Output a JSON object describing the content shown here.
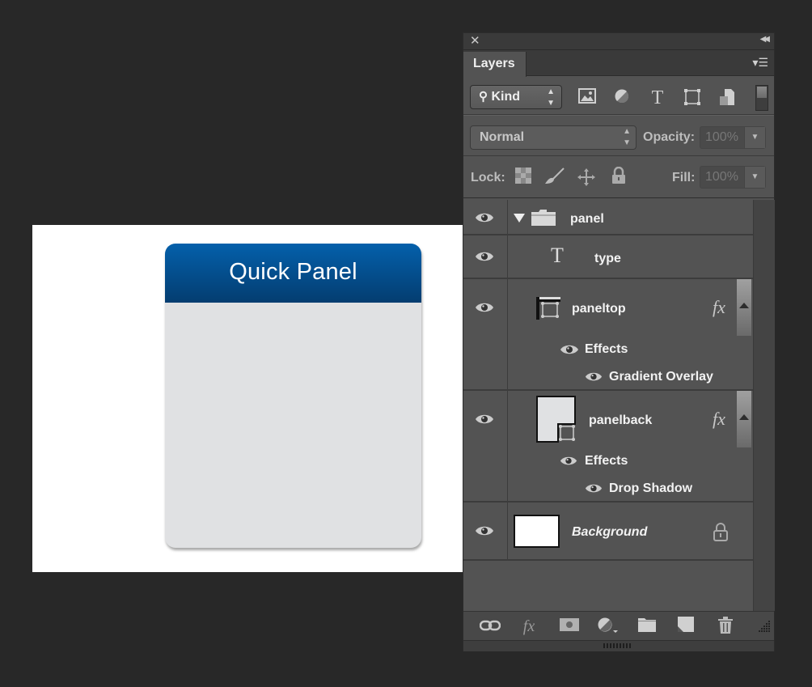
{
  "canvas": {
    "panel_title": "Quick Panel",
    "colors": {
      "header_top": "#0460ab",
      "header_bottom": "#043d70",
      "body": "#e0e1e3"
    }
  },
  "layers_panel": {
    "tab_label": "Layers",
    "icons": {
      "close": "close-icon",
      "collapse": "collapse-double-arrow-icon",
      "menu": "panel-menu-icon"
    },
    "filter": {
      "kind_label": "Kind",
      "filter_icons": [
        "image-filter-icon",
        "adjustment-filter-icon",
        "type-filter-icon",
        "shape-filter-icon",
        "smart-object-filter-icon"
      ]
    },
    "blend_mode": "Normal",
    "opacity_label": "Opacity:",
    "opacity_value": "100%",
    "lock_label": "Lock:",
    "fill_label": "Fill:",
    "fill_value": "100%",
    "layers": [
      {
        "name": "panel",
        "type": "group",
        "expanded": true
      },
      {
        "name": "type",
        "type": "text"
      },
      {
        "name": "paneltop",
        "type": "shape",
        "fx": "fx",
        "effects_label": "Effects",
        "effects": [
          "Gradient Overlay"
        ]
      },
      {
        "name": "panelback",
        "type": "shape",
        "fx": "fx",
        "effects_label": "Effects",
        "effects": [
          "Drop Shadow"
        ]
      },
      {
        "name": "Background",
        "type": "background",
        "locked": true
      }
    ],
    "bottom_icons": [
      "link-layers-icon",
      "add-style-icon",
      "add-mask-icon",
      "new-adjustment-icon",
      "new-group-icon",
      "new-layer-icon",
      "delete-icon"
    ]
  }
}
